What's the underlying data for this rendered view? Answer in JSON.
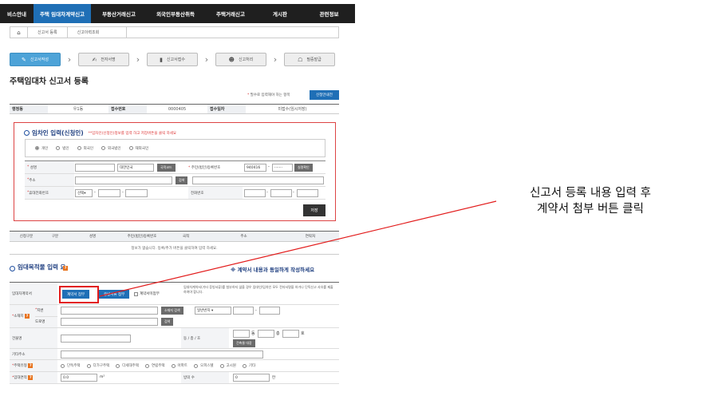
{
  "nav": {
    "items": [
      "비스안내",
      "주택 임대차계약신고",
      "부동산거래신고",
      "외국인부동산취득",
      "주택거래신고",
      "게시판",
      "관련정보"
    ],
    "active_index": 1
  },
  "breadcrumb": [
    "신고서 등록",
    "신고이력조회"
  ],
  "steps": [
    {
      "label": "신고서작성",
      "icon": "pencil-icon",
      "glyph": "✎"
    },
    {
      "label": "전자서명",
      "icon": "sign-icon",
      "glyph": "✍"
    },
    {
      "label": "신고서접수",
      "icon": "document-icon",
      "glyph": "▮"
    },
    {
      "label": "신고처리",
      "icon": "person-icon",
      "glyph": "☻"
    },
    {
      "label": "필증발급",
      "icon": "certificate-icon",
      "glyph": "☖"
    }
  ],
  "page_title": "주택임대차 신고서 등록",
  "required_note": {
    "star": "*",
    "text": " 필수로 입력해야 하는 항목"
  },
  "guide_button": "신청안내전",
  "info_table": {
    "agency_label": "행정동",
    "agency_value": "우1동",
    "receipt_label": "접수번호",
    "receipt_value": "0000405",
    "date_label": "접수일자",
    "date_value": "미접수(임시저장)"
  },
  "lessee": {
    "title": "임차인 입력(신청인)",
    "hint": "**임차인(신청인)정보를 입력 하고 저장버튼을 클릭 하세요",
    "types": [
      "개인",
      "법인",
      "외국인",
      "외국법인",
      "재외국민"
    ],
    "selected_type": 0,
    "name_label": "성명",
    "nationality_value": "대한민국",
    "country_code_button": "국적코드",
    "id_label": "주민(법인)등록번호",
    "id_front_value": "940416",
    "id_back_value": "·······",
    "verify_button": "실명확인",
    "address_label": "주소",
    "search_button": "검색",
    "mobile_label": "휴대전화번호",
    "mobile_select": "선택",
    "dash": "-",
    "phone_label": "전화번호",
    "save_button": "저장"
  },
  "list_table": {
    "headers": [
      "신청구분",
      "구분",
      "성명",
      "주민(법인)등록번호",
      "국적",
      "주소",
      "연락처"
    ],
    "empty_message": "정보가 없습니다.  등록/추가 버튼을 클릭하여 입력 하세요."
  },
  "rental": {
    "title": "임대목적물 입력 요",
    "notice": "※ 계약서 내용과 동일하게 작성하세요",
    "contract_label": "임대차계약서",
    "attach_contract_button": "계약서 첨부",
    "attach_other_button": "증빙서류 첨부",
    "no_contract_label": "계약서미첨부",
    "contract_note": "임대차계약서(기타 증빙서류)를 첨부하지 않을 경우 임대인/임차인 모두 전자서명을 하거나 단독신고 사유를 제출하여야 합니다.",
    "location_label": "소재지",
    "lot_label": "지번",
    "lot_search_button": "소재지 검색",
    "lot_type_value": "일반번지",
    "road_label": "도로명",
    "road_search_button": "검색",
    "building_label": "건물명",
    "unit_label": "동 / 층 / 호",
    "dong": "동",
    "floor": "층",
    "ho": "호",
    "building_target_button": "건축물 대장",
    "other_address_label": "기타주소",
    "house_type_label": "주택유형",
    "house_types": [
      "단독주택",
      "다가구주택",
      "다세대주택",
      "연립주택",
      "아파트",
      "오피스텔",
      "고시원",
      "기타"
    ],
    "area_label": "임대면적",
    "area_value": "0.0",
    "area_unit": "m²",
    "rooms_label": "방의 수",
    "rooms_value": "0",
    "rooms_unit": "칸"
  },
  "callout": {
    "line1": "신고서 등록 내용 입력 후",
    "line2": "계약서 첨부 버튼 클릭"
  },
  "colors": {
    "accent": "#1f6fb6",
    "annotation": "#e21b1b",
    "nav_bg": "#1f1f1f"
  }
}
